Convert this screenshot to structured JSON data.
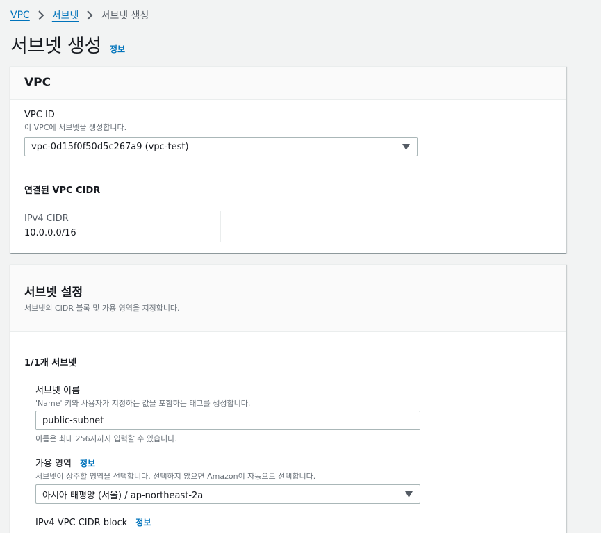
{
  "breadcrumb": {
    "items": [
      "VPC",
      "서브넷"
    ],
    "current": "서브넷 생성"
  },
  "page": {
    "title": "서브넷 생성",
    "info": "정보"
  },
  "vpc_section": {
    "title": "VPC",
    "vpc_id_label": "VPC ID",
    "vpc_id_desc": "이 VPC에 서브넷을 생성합니다.",
    "vpc_id_value": "vpc-0d15f0f50d5c267a9 (vpc-test)",
    "cidr_heading": "연결된 VPC CIDR",
    "ipv4_label": "IPv4 CIDR",
    "ipv4_value": "10.0.0.0/16"
  },
  "subnet_section": {
    "title": "서브넷 설정",
    "desc": "서브넷의 CIDR 블록 및 가용 영역을 지정합니다.",
    "count": "1/1개 서브넷",
    "name_label": "서브넷 이름",
    "name_desc": "'Name' 키와 사용자가 지정하는 값을 포함하는 태그를 생성합니다.",
    "name_value": "public-subnet",
    "name_constraint": "이름은 최대 256자까지 입력할 수 있습니다.",
    "az_label": "가용 영역",
    "az_info": "정보",
    "az_desc": "서브넷이 상주할 영역을 선택합니다. 선택하지 않으면 Amazon이 자동으로 선택합니다.",
    "az_value": "아시아 태평양 (서울) / ap-northeast-2a",
    "cidr_label": "IPv4 VPC CIDR block",
    "cidr_info": "정보"
  },
  "colors": {
    "link": "#0073bb",
    "background": "#f2f3f3",
    "text": "#16191f"
  }
}
